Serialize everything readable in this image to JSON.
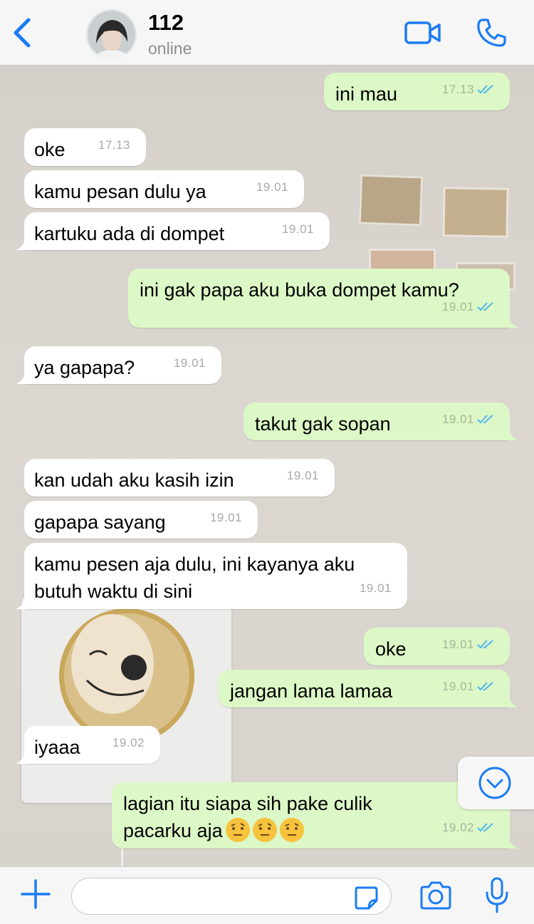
{
  "header": {
    "contact_name": "112",
    "status": "online"
  },
  "colors": {
    "accent": "#1a7cf5",
    "outgoing_bubble": "#dcf8c6",
    "incoming_bubble": "#ffffff",
    "read_ticks": "#4fb6ec"
  },
  "icons": {
    "back": "chevron-left-icon",
    "video": "video-call-icon",
    "call": "phone-icon",
    "scroll": "chevron-down-circle-icon",
    "plus": "plus-icon",
    "sticker": "sticker-icon",
    "camera": "camera-icon",
    "mic": "microphone-icon"
  },
  "messages": [
    {
      "dir": "out",
      "text": "ini mau",
      "time": "17.13"
    },
    {
      "dir": "in",
      "text": "oke",
      "time": "17.13"
    },
    {
      "dir": "in",
      "text": "kamu pesan dulu ya",
      "time": "19.01"
    },
    {
      "dir": "in",
      "text": "kartuku ada di dompet",
      "time": "19.01"
    },
    {
      "dir": "out",
      "text": "ini gak papa aku buka dompet kamu?",
      "time": "19.01"
    },
    {
      "dir": "in",
      "text": "ya gapapa?",
      "time": "19.01"
    },
    {
      "dir": "out",
      "text": "takut gak sopan",
      "time": "19.01"
    },
    {
      "dir": "in",
      "text": "kan udah aku kasih izin",
      "time": "19.01"
    },
    {
      "dir": "in",
      "text": "gapapa sayang",
      "time": "19.01"
    },
    {
      "dir": "in",
      "line1": "kamu pesen aja dulu, ini kayanya aku",
      "line2": "butuh waktu di sini",
      "time": "19.01"
    },
    {
      "dir": "out",
      "text": "oke",
      "time": "19.01"
    },
    {
      "dir": "out",
      "text": "jangan lama lamaa",
      "time": "19.01"
    },
    {
      "dir": "in",
      "text": "iyaaa",
      "time": "19.02"
    },
    {
      "dir": "out",
      "line1": "lagian itu siapa sih pake culik",
      "line2": "pacarku aja",
      "emoji": "face-with-raised-eyebrow x3",
      "time": "19.02"
    }
  ],
  "composer": {
    "value": "",
    "placeholder": ""
  }
}
